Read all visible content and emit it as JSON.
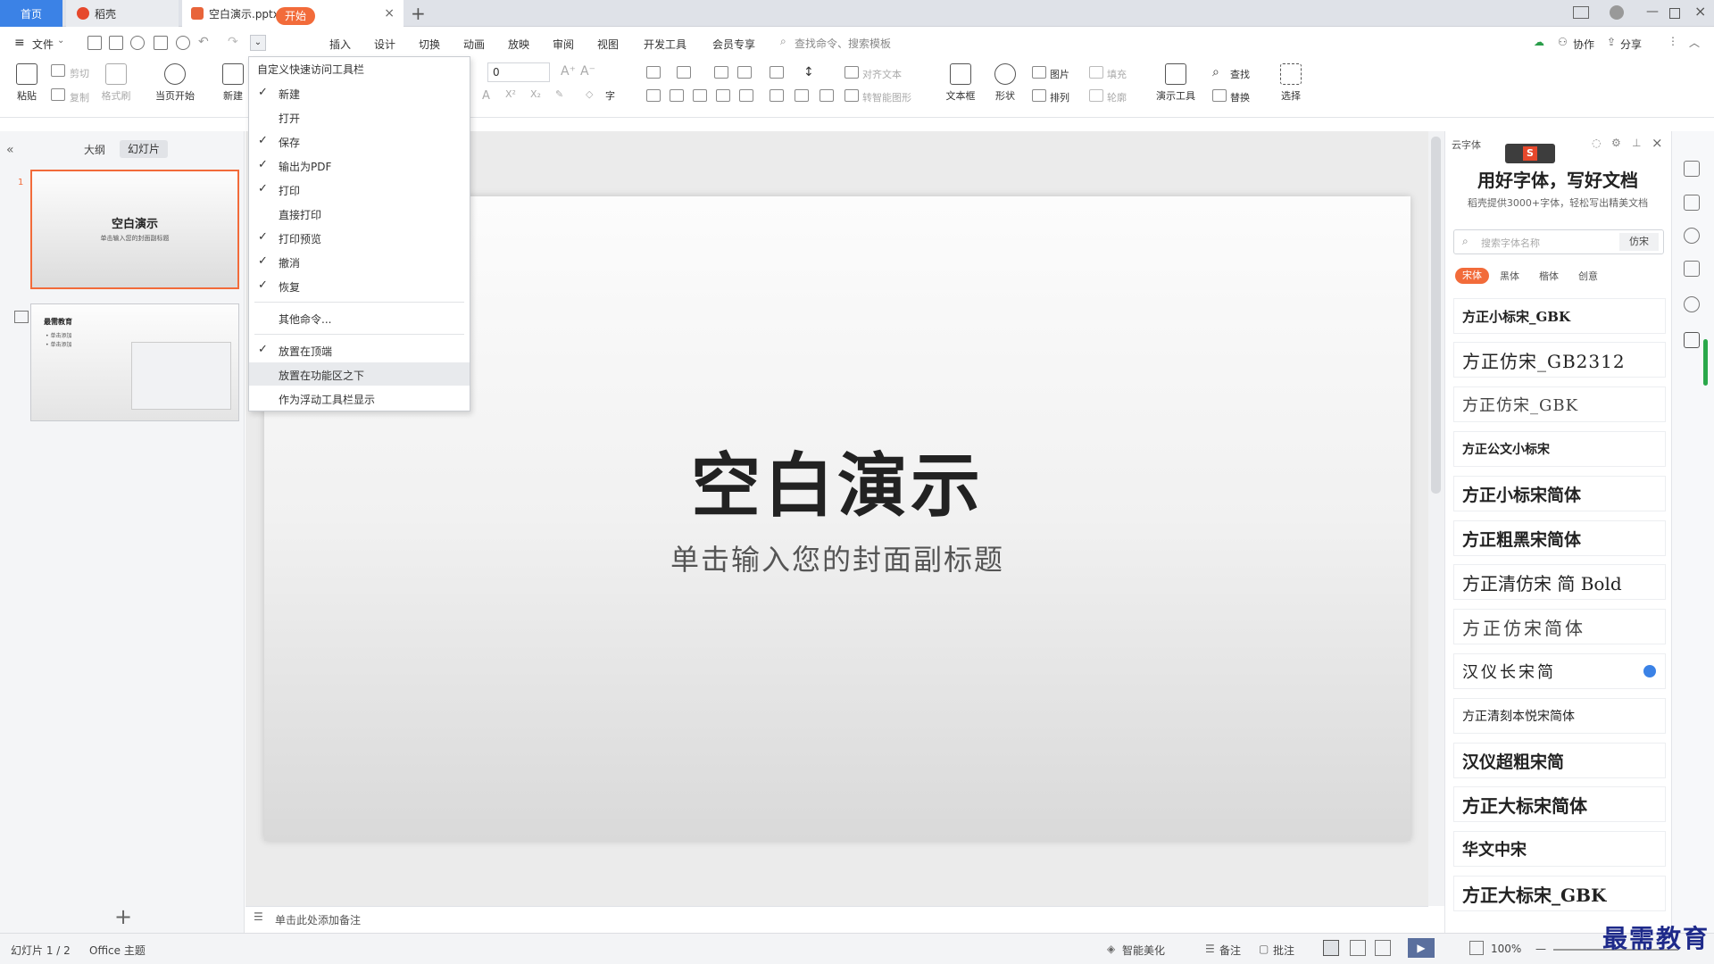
{
  "tabs": {
    "home": "首页",
    "daoke": "稻壳",
    "file": "空白演示.pptx",
    "add": "+",
    "close": "×"
  },
  "menu": {
    "file": "文件",
    "items": [
      "开始",
      "插入",
      "设计",
      "切换",
      "动画",
      "放映",
      "审阅",
      "视图",
      "开发工具",
      "会员专享"
    ],
    "search": "查找命令、搜索模板",
    "collab": "协作",
    "share": "分享"
  },
  "ribbon": {
    "paste": "粘贴",
    "cut": "剪切",
    "copy": "复制",
    "format_painter": "格式刷",
    "play_from": "当页开始",
    "new_slide": "新建",
    "font_size": "0",
    "align_text": "对齐文本",
    "smart_graphic": "转智能图形",
    "textbox": "文本框",
    "shape": "形状",
    "picture": "图片",
    "arrange": "排列",
    "fill": "填充",
    "outline": "轮廓",
    "present_tools": "演示工具",
    "find": "查找",
    "replace": "替换",
    "select": "选择"
  },
  "left_panel": {
    "outline": "大纲",
    "slides": "幻灯片",
    "num1": "1",
    "thumb1_title": "空白演示",
    "thumb1_sub": "单击输入您的封面副标题",
    "thumb2_title": "最需教育",
    "thumb2_line1": "• 单击添加",
    "thumb2_line2": "• 单击添加"
  },
  "slide": {
    "title": "空白演示",
    "subtitle": "单击输入您的封面副标题"
  },
  "notes": "单击此处添加备注",
  "dropdown": {
    "title": "自定义快速访问工具栏",
    "items": [
      {
        "label": "新建",
        "checked": true
      },
      {
        "label": "打开",
        "checked": false
      },
      {
        "label": "保存",
        "checked": true
      },
      {
        "label": "输出为PDF",
        "checked": true
      },
      {
        "label": "打印",
        "checked": true
      },
      {
        "label": "直接打印",
        "checked": false
      },
      {
        "label": "打印预览",
        "checked": true
      },
      {
        "label": "撤消",
        "checked": true
      },
      {
        "label": "恢复",
        "checked": true
      }
    ],
    "more": "其他命令...",
    "position": [
      {
        "label": "放置在顶端",
        "checked": true
      },
      {
        "label": "放置在功能区之下",
        "checked": false,
        "hover": true
      },
      {
        "label": "作为浮动工具栏显示",
        "checked": false
      }
    ]
  },
  "font_panel": {
    "cloud": "云字体",
    "title": "用好字体，写好文档",
    "subtitle": "稻壳提供3000+字体，轻松写出精美文档",
    "search_placeholder": "搜索字体名称",
    "search_btn": "仿宋",
    "categories": [
      "宋体",
      "黑体",
      "楷体",
      "创意"
    ],
    "fonts": [
      "方正小标宋_GBK",
      "方正仿宋_GB2312",
      "方正仿宋_GBK",
      "方正公文小标宋",
      "方正小标宋简体",
      "方正粗黑宋简体",
      "方正清仿宋 简 Bold",
      "方正仿宋简体",
      "汉仪长宋简",
      "方正清刻本悦宋简体",
      "汉仪超粗宋简",
      "方正大标宋简体",
      "华文中宋",
      "方正大标宋_GBK"
    ]
  },
  "status": {
    "slide": "幻灯片 1 / 2",
    "theme": "Office 主题",
    "beautify": "智能美化",
    "notes": "备注",
    "comments": "批注",
    "zoom": "100%"
  },
  "watermark": "最需教育",
  "colors": {
    "accent": "#f26b3a",
    "home_tab": "#3b82e6"
  }
}
